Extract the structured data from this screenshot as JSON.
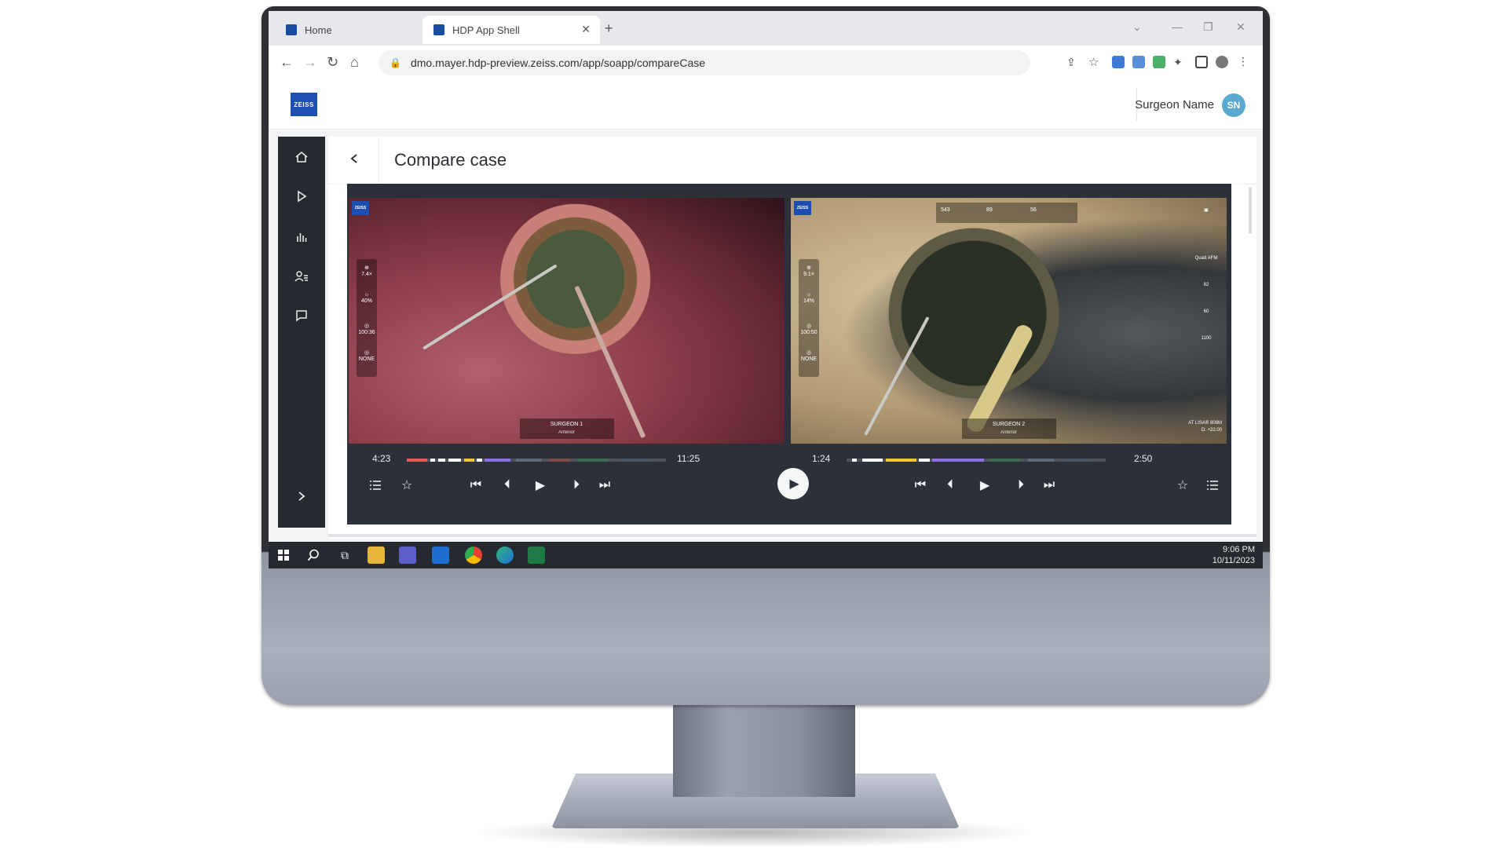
{
  "browser": {
    "tabs": [
      {
        "label": "Home",
        "active": false
      },
      {
        "label": "HDP App Shell",
        "active": true
      }
    ],
    "new_tab": "+",
    "url": "dmo.mayer.hdp-preview.zeiss.com/app/soapp/compareCase"
  },
  "header": {
    "logo_text": "ZEISS",
    "user_name": "Surgeon Name",
    "avatar_initials": "SN"
  },
  "sidebar": {
    "items": [
      {
        "icon": "home-icon"
      },
      {
        "icon": "play-icon"
      },
      {
        "icon": "chart-icon"
      },
      {
        "icon": "user-list-icon"
      },
      {
        "icon": "comment-icon"
      }
    ],
    "expand_icon": "chevron-right-icon"
  },
  "page": {
    "title": "Compare case"
  },
  "videos": {
    "left": {
      "caption_title": "SURGEON 1",
      "caption_sub": "Anterior",
      "stats": [
        "7.4×",
        "40%",
        "100:36",
        "NONE"
      ],
      "current_time": "4:23",
      "duration": "11:25"
    },
    "right": {
      "caption_title": "SURGEON 2",
      "caption_sub": "Anterior",
      "stats": [
        "9.1×",
        "14%",
        "100:50",
        "NONE"
      ],
      "top_stats": [
        "543",
        "89",
        "56"
      ],
      "right_stats": [
        "Quad AFM",
        "82",
        "60",
        "1100"
      ],
      "lens_label": "AT LISA® 809M",
      "lens_power": "D: +22.00",
      "current_time": "1:24",
      "duration": "2:50"
    }
  },
  "taskbar": {
    "time": "9:06 PM",
    "date": "10/11/2023"
  },
  "colors": {
    "accent": "#1c4fb0",
    "avatar": "#5aa9cf",
    "sidebar": "#26292f",
    "player": "#2c3038"
  }
}
